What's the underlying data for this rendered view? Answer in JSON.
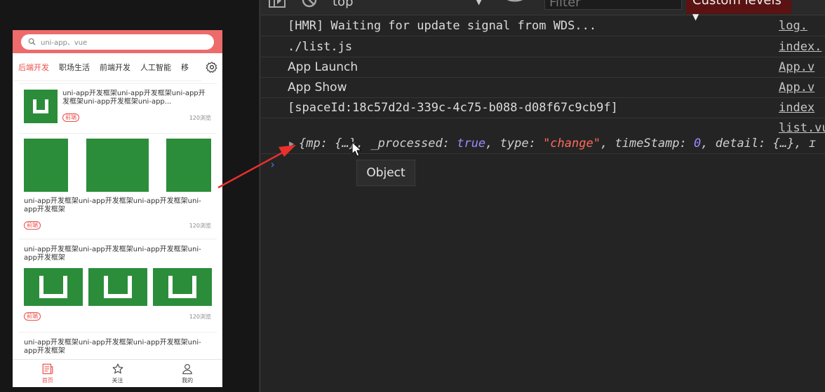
{
  "simulator": {
    "search_placeholder": "uni-app、vue",
    "tabs": [
      "后端开发",
      "职场生活",
      "前端开发",
      "人工智能",
      "移"
    ],
    "cards": [
      {
        "title": "uni-app开发框架uni-app开发框架uni-app开发框架uni-app开发框架uni-app...",
        "tag": "前端",
        "views": "120浏览"
      },
      {
        "title": "uni-app开发框架uni-app开发框架uni-app开发框架uni-app开发框架",
        "tag": "前端",
        "views": "120浏览"
      },
      {
        "title": "uni-app开发框架uni-app开发框架uni-app开发框架uni-app开发框架",
        "tag": "前端",
        "views": "120浏览"
      },
      {
        "title": "uni-app开发框架uni-app开发框架uni-app开发框架uni-app开发框架"
      }
    ],
    "tabbar": [
      "首页",
      "关注",
      "我的"
    ],
    "brand_color": "#ee6b6b",
    "accent_color": "#e9504b",
    "image_green": "#2b8d3a"
  },
  "devtools": {
    "context": "top",
    "filter_placeholder": "Filter",
    "levels": "Custom levels",
    "logs": [
      {
        "msg": "[HMR] Waiting for update signal from WDS...",
        "src": "log."
      },
      {
        "msg": "./list.js",
        "src": "index."
      },
      {
        "msg": "App Launch",
        "src": "App.v"
      },
      {
        "msg": "App Show",
        "src": "App.v"
      },
      {
        "msg": "[spaceId:18c57d2d-339c-4c75-b088-d08f67c9cb9f]",
        "src": "index"
      },
      {
        "msg": "",
        "src": "list.vu"
      }
    ],
    "object_preview": {
      "p1": "{",
      "k1": "mp: ",
      "v1": "{…}",
      "k2": ", _processed: ",
      "v2": "true",
      "k3": ", type: ",
      "v3": "\"change\"",
      "k4": ", timeStamp: ",
      "v4": "0",
      "k5": ", detail: {…}, ",
      "tail": "ɪ"
    },
    "tooltip": "Object",
    "prompt": "›"
  }
}
